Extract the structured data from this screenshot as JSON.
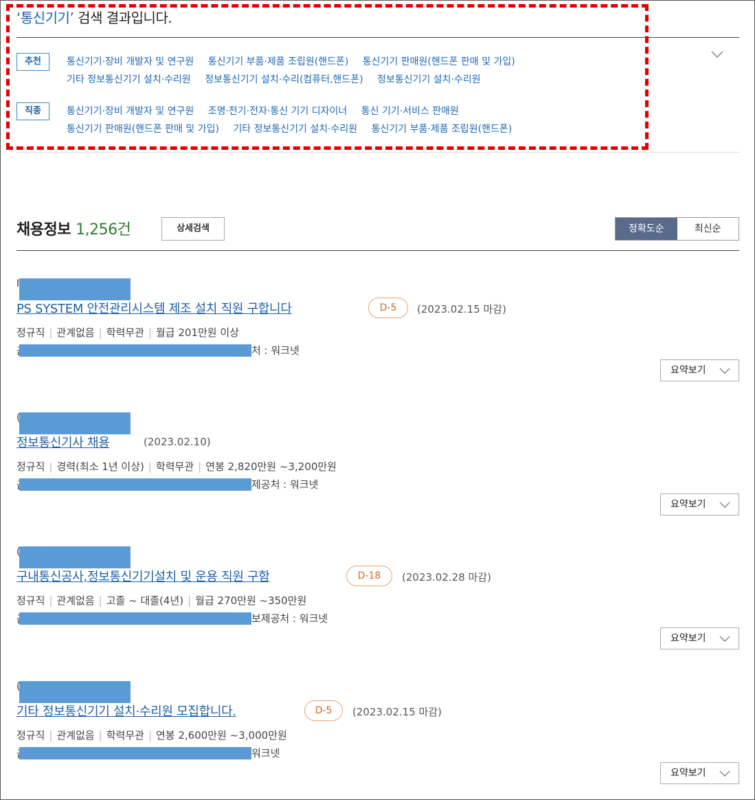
{
  "search": {
    "title_keyword": "‘통신기기’",
    "title_rest": " 검색 결과입니다."
  },
  "recommend": {
    "tag": "추천",
    "items": [
      "통신기기·장비 개발자 및 연구원",
      "통신기기 부품·제품 조립원(핸드폰)",
      "통신기기 판매원(핸드폰 판매 및 가입)",
      "기타 정보통신기기 설치·수리원",
      "정보통신기기 설치·수리(컴퓨터,핸드폰)",
      "정보통신기기 설치·수리원"
    ]
  },
  "occupation": {
    "tag": "직종",
    "items": [
      "통신기기·장비 개발자 및 연구원",
      "조명·전기·전자·통신 기기 디자이너",
      "통신 기기·서비스 판매원",
      "통신기기 판매원(핸드폰 판매 및 가입)",
      "기타 정보통신기기 설치·수리원",
      "통신기기 부품·제품 조립원(핸드폰)"
    ]
  },
  "jobs_header": {
    "label": "채용정보",
    "count": "1,256건",
    "detail_search": "상세검색",
    "sort_accuracy": "정확도순",
    "sort_latest": "최신순"
  },
  "colors": {
    "accent_blue": "#1e5fa8",
    "highlight_red": "#e00000",
    "redaction_blue": "#5b9bd5",
    "count_green": "#2e7d32",
    "dday_orange": "#d06a2e"
  },
  "jobs": [
    {
      "company_prefix": "I",
      "title": "PS SYSTEM 안전관리시스템 제조 설치 직원 구합니다",
      "dday": "D-5",
      "deadline": "(2023.02.15 마감)",
      "employment": "정규직",
      "experience": "관계없음",
      "education": "학력무관",
      "salary": "월급 201만원 이상",
      "source_prefix": "급",
      "source": "처 : 워크넷",
      "summary": "요약보기"
    },
    {
      "company_prefix": "(",
      "title": "정보통신기사 채용",
      "dday": "",
      "deadline": "(2023.02.10)",
      "employment": "정규직",
      "experience": "경력(최소 1년 이상)",
      "education": "학력무관",
      "salary": "연봉 2,820만원 ~3,200만원",
      "source_prefix": "급",
      "source": "제공처 : 워크넷",
      "summary": "요약보기"
    },
    {
      "company_prefix": "(",
      "title": "구내통신공사,정보통신기기설치 및 운용 직원 구함",
      "dday": "D-18",
      "deadline": "(2023.02.28 마감)",
      "employment": "정규직",
      "experience": "관계없음",
      "education": "고졸 ~ 대졸(4년)",
      "salary": "월급 270만원 ~350만원",
      "source_prefix": "급",
      "source": "보제공처 : 워크넷",
      "summary": "요약보기"
    },
    {
      "company_prefix": "(",
      "title": "기타 정보통신기기 설치·수리원 모집합니다.",
      "dday": "D-5",
      "deadline": "(2023.02.15 마감)",
      "employment": "정규직",
      "experience": "관계없음",
      "education": "학력무관",
      "salary": "연봉 2,600만원 ~3,000만원",
      "source_prefix": "급",
      "source": "워크넷",
      "summary": "요약보기"
    }
  ]
}
